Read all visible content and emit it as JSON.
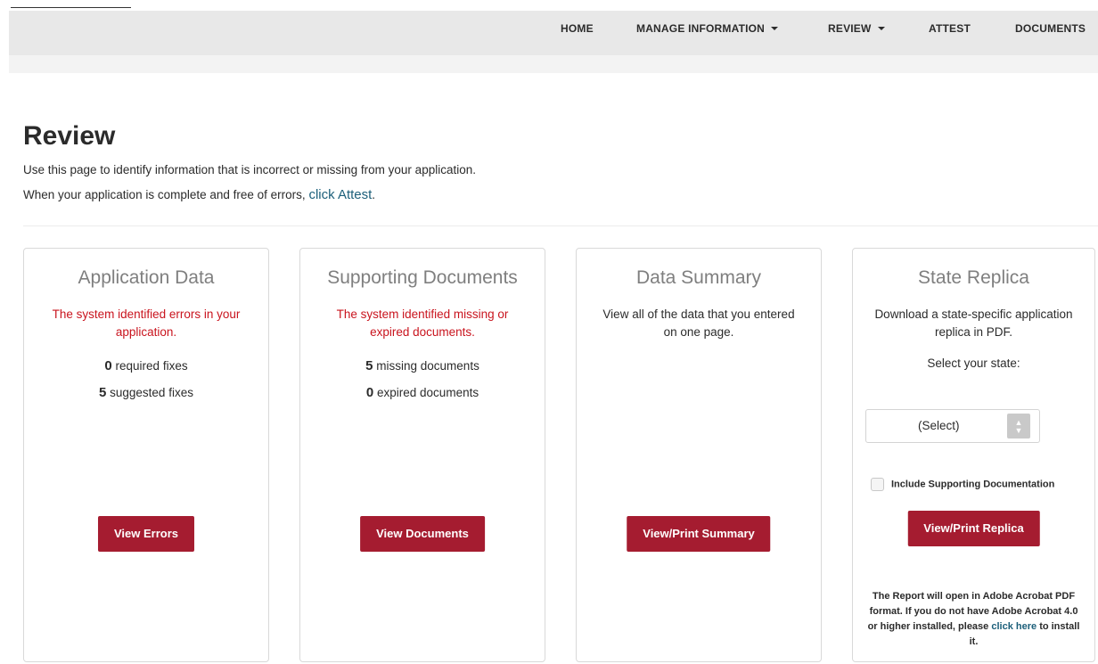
{
  "nav": {
    "home": "HOME",
    "manage_information": "MANAGE INFORMATION",
    "review": "REVIEW",
    "attest": "ATTEST",
    "documents": "DOCUMENTS"
  },
  "page": {
    "title": "Review",
    "intro_line1": "Use this page to identify information that is incorrect or missing from your application.",
    "intro_line2_prefix": "When your application is complete and free of errors,",
    "intro_link": "click Attest",
    "intro_line2_suffix": "."
  },
  "cards": {
    "application_data": {
      "title": "Application Data",
      "error": "The system identified errors in your application.",
      "required_count": "0",
      "required_label": "required fixes",
      "suggested_count": "5",
      "suggested_label": "suggested fixes",
      "button": "View Errors"
    },
    "supporting_documents": {
      "title": "Supporting Documents",
      "error": "The system identified missing or expired documents.",
      "missing_count": "5",
      "missing_label": "missing documents",
      "expired_count": "0",
      "expired_label": "expired documents",
      "button": "View Documents"
    },
    "data_summary": {
      "title": "Data Summary",
      "desc": "View all of the data that you entered on one page.",
      "button": "View/Print Summary"
    },
    "state_replica": {
      "title": "State Replica",
      "desc": "Download a state-specific application replica in PDF.",
      "select_label": "Select your state:",
      "select_value": "(Select)",
      "checkbox_label": "Include Supporting Documentation",
      "button": "View/Print Replica",
      "note_text": "The Report will open in Adobe Acrobat PDF format. If you do not have Adobe Acrobat 4.0 or higher installed, please",
      "note_link": "click here",
      "note_suffix": "to install it."
    }
  },
  "colors": {
    "accent": "#a51c30",
    "error_text": "#c9141e",
    "link": "#1c5f7a",
    "nav_bg": "#e8e8e8"
  }
}
